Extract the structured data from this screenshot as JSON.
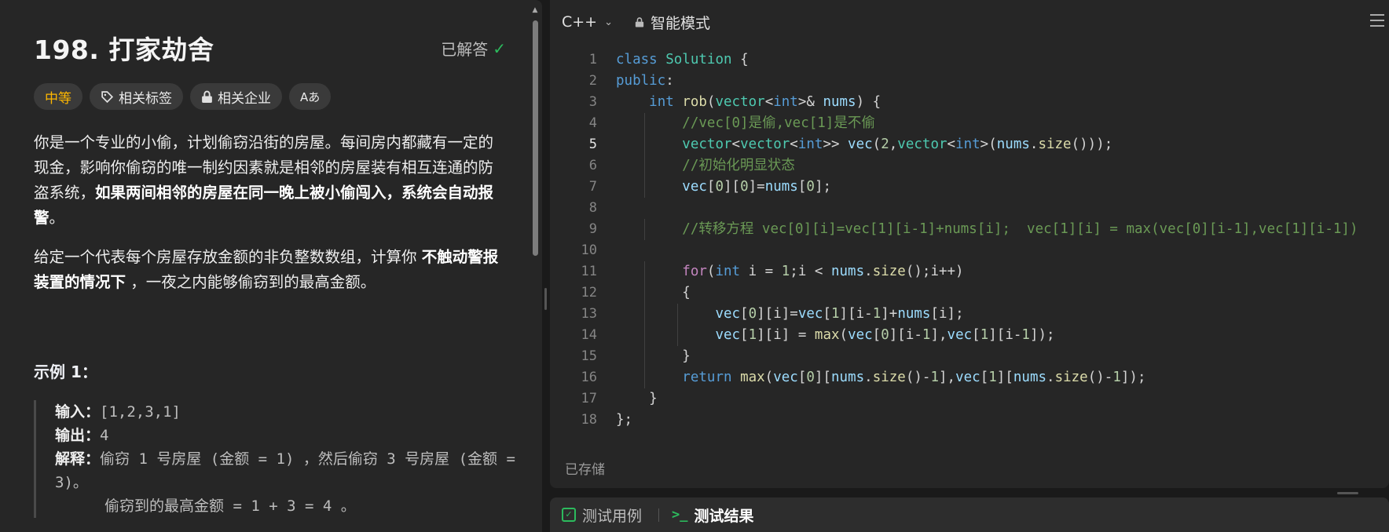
{
  "problem": {
    "title": "198. 打家劫舍",
    "status": "已解答",
    "tags": {
      "difficulty": "中等",
      "topics": "相关标签",
      "companies": "相关企业",
      "font": "Aあ"
    },
    "para1_plain": "你是一个专业的小偷，计划偷窃沿街的房屋。每间房内都藏有一定的现金，影响你偷窃的唯一制约因素就是相邻的房屋装有相互连通的防盗系统，",
    "para1_bold": "如果两间相邻的房屋在同一晚上被小偷闯入，系统会自动报警",
    "para1_end": "。",
    "para2_plain": "给定一个代表每个房屋存放金额的非负整数数组，计算你 ",
    "para2_bold": "不触动警报装置的情况下",
    "para2_end": " ，一夜之内能够偷窃到的最高金额。",
    "example_title": "示例 1：",
    "example": {
      "input_label": "输入：",
      "input_value": "[1,2,3,1]",
      "output_label": "输出：",
      "output_value": "4",
      "explain_label": "解释：",
      "explain_value": "偷窃 1 号房屋 (金额 = 1) ，然后偷窃 3 号房屋 (金额 = 3)。",
      "explain_cont": "偷窃到的最高金额 = 1 + 3 = 4 。"
    }
  },
  "editor": {
    "language": "C++",
    "mode": "智能模式",
    "saved": "已存储",
    "line_numbers": [
      "1",
      "2",
      "3",
      "4",
      "5",
      "6",
      "7",
      "8",
      "9",
      "10",
      "11",
      "12",
      "13",
      "14",
      "15",
      "16",
      "17",
      "18"
    ],
    "active_line": "5",
    "lines": [
      "class Solution {",
      "public:",
      "    int rob(vector<int>& nums) {",
      "        //vec[0]是偷,vec[1]是不偷",
      "        vector<vector<int>> vec(2,vector<int>(nums.size()));",
      "        //初始化明显状态",
      "        vec[0][0]=nums[0];",
      "",
      "        //转移方程 vec[0][i]=vec[1][i-1]+nums[i];  vec[1][i] = max(vec[0][i-1],vec[1][i-1])",
      "",
      "        for(int i = 1;i < nums.size();i++)",
      "        {",
      "            vec[0][i]=vec[1][i-1]+nums[i];",
      "            vec[1][i] = max(vec[0][i-1],vec[1][i-1]);",
      "        }",
      "        return max(vec[0][nums.size()-1],vec[1][nums.size()-1]);",
      "    }",
      "};"
    ]
  },
  "bottom": {
    "tab_testcase": "测试用例",
    "tab_result": "测试结果",
    "prompt_glyph": ">_"
  },
  "colors": {
    "accent_green": "#2cbb5d",
    "difficulty_medium": "#ffb800",
    "panel_bg": "#262626"
  }
}
